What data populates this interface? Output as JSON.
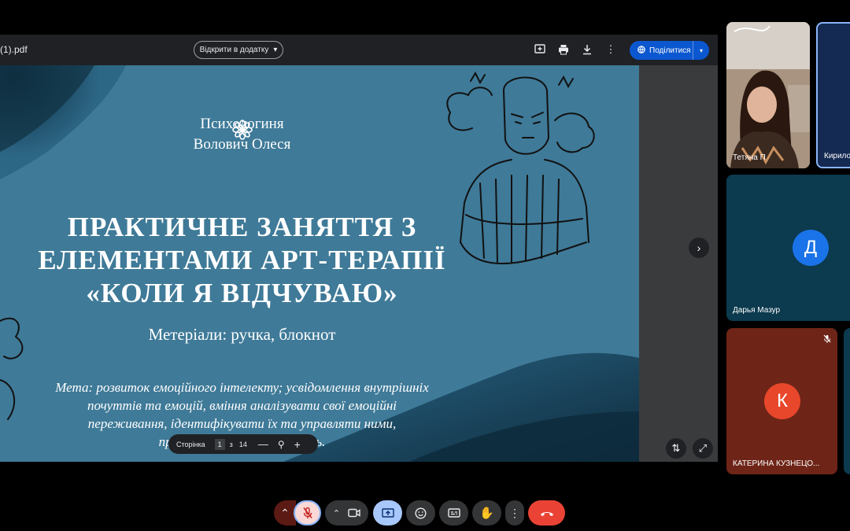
{
  "viewer": {
    "file_name": "(1).pdf",
    "open_with_label": "Відкрити в додатку",
    "share_label": "Поділитися",
    "icons": [
      "add-comment-icon",
      "print-icon",
      "download-icon",
      "more-vert-icon"
    ]
  },
  "slide": {
    "author_line1": "Психологиня",
    "author_line2": "Волович Олеся",
    "title_line1": "ПРАКТИЧНЕ ЗАНЯТТЯ З",
    "title_line2": "ЕЛЕМЕНТАМИ АРТ-ТЕРАПІЇ",
    "title_line3": "«КОЛИ Я ВІДЧУВАЮ»",
    "materials": "Метеріали: ручка, блокнот",
    "goal_line1": "Мета: розвиток емоційного інтелекту; усвідомлення внутрішніх",
    "goal_line2": "почуттів та емоцій, вміння аналізувати свої емоційні",
    "goal_line3": "переживання, ідентифікувати їх та управляти ними,",
    "goal_line4": "протидії впливу переживань."
  },
  "pager": {
    "label": "Сторінка",
    "current": "1",
    "separator": "з",
    "total": "14"
  },
  "participants": [
    {
      "name": "Тетяна П"
    },
    {
      "name": "Кирило"
    },
    {
      "name": "Дарья Мазур",
      "initial": "Д"
    },
    {
      "name": "КАТЕРИНА КУЗНЕЦО...",
      "initial": "К"
    }
  ],
  "colors": {
    "slide_bg": "#3f7a98",
    "share_bg": "#0b57d0",
    "avatar_blue": "#1a73e8",
    "avatar_red": "#e8472b",
    "end_call": "#ea4335",
    "present_active": "#a8c7fa"
  }
}
